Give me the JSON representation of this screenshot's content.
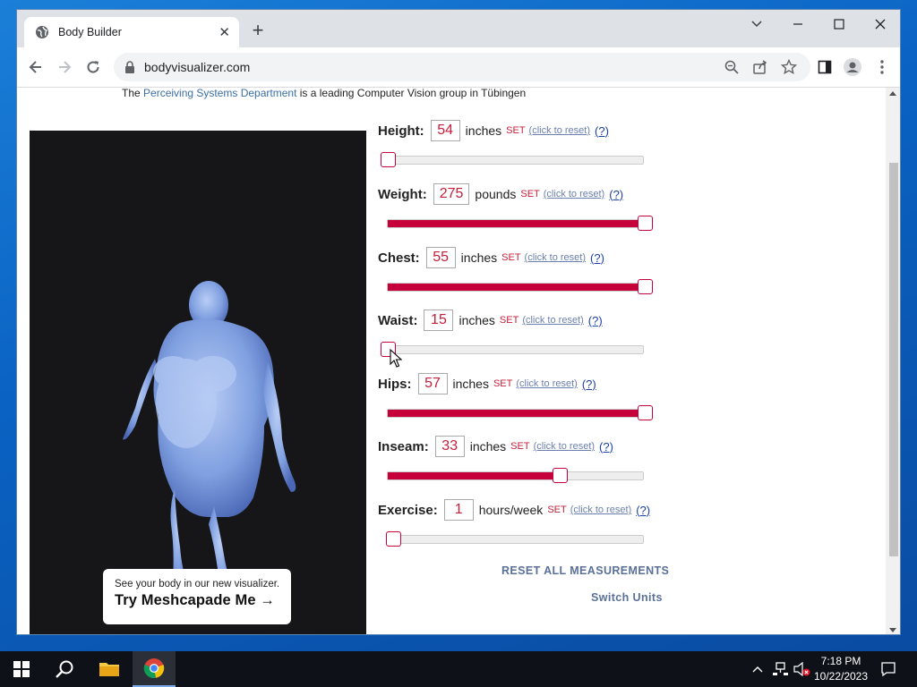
{
  "browser": {
    "tab_title": "Body Builder",
    "url": "bodyvisualizer.com"
  },
  "page": {
    "intro_prefix": "The ",
    "intro_link": "Perceiving Systems Department",
    "intro_suffix": " is a leading Computer Vision group in Tübingen",
    "promo_small": "See your body in our new visualizer.",
    "promo_big": "Try Meshcapade Me →",
    "measurements": [
      {
        "label": "Height:",
        "value": "54",
        "unit": "inches",
        "set": "SET",
        "reset": "(click to reset)",
        "help": "(?)",
        "level": 0.0
      },
      {
        "label": "Weight:",
        "value": "275",
        "unit": "pounds",
        "set": "SET",
        "reset": "(click to reset)",
        "help": "(?)",
        "level": 1.0
      },
      {
        "label": "Chest:",
        "value": "55",
        "unit": "inches",
        "set": "SET",
        "reset": "(click to reset)",
        "help": "(?)",
        "level": 1.0
      },
      {
        "label": "Waist:",
        "value": "15",
        "unit": "inches",
        "set": "SET",
        "reset": "(click to reset)",
        "help": "(?)",
        "level": 0.0
      },
      {
        "label": "Hips:",
        "value": "57",
        "unit": "inches",
        "set": "SET",
        "reset": "(click to reset)",
        "help": "(?)",
        "level": 1.0
      },
      {
        "label": "Inseam:",
        "value": "33",
        "unit": "inches",
        "set": "SET",
        "reset": "(click to reset)",
        "help": "(?)",
        "level": 0.67
      },
      {
        "label": "Exercise:",
        "value": "1",
        "unit": "hours/week",
        "set": "SET",
        "reset": "(click to reset)",
        "help": "(?)",
        "level": 0.02
      }
    ],
    "reset_all": "RESET ALL MEASUREMENTS",
    "switch_units": "Switch Units"
  },
  "taskbar": {
    "time": "7:18 PM",
    "date": "10/22/2023"
  },
  "colors": {
    "slider_fill": "#c5003a",
    "value_text": "#c41e3a",
    "body_model": "#7f9fe0"
  }
}
